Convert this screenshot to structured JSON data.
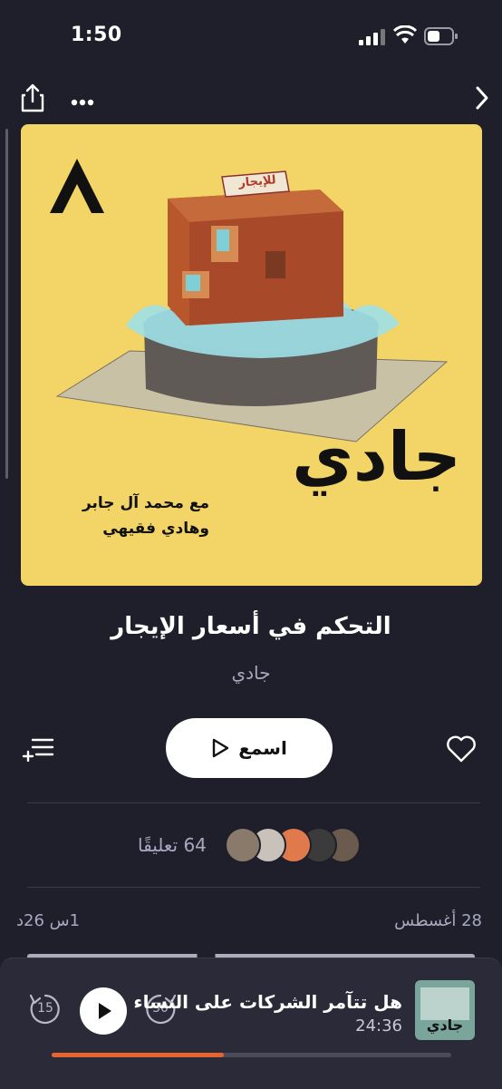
{
  "status_bar": {
    "time": "1:50",
    "battery_level": 0.5
  },
  "artwork": {
    "number_glyph": "٨",
    "sign_text": "للإيجار",
    "logo_text": "جادي",
    "hosts_line1": "مع محمد آل جابر",
    "hosts_line2": "وهادي فقيهي",
    "background_color": "#f3d466"
  },
  "episode": {
    "title": "التحكم في أسعار الإيجار",
    "show": "جادي"
  },
  "actions": {
    "play_label": "اسمع"
  },
  "comments": {
    "label": "64 تعليقًا"
  },
  "meta": {
    "date": "28 أغسطس",
    "duration": "1س 26د"
  },
  "mini_player": {
    "title": "هل تتآمر الشركات على النساء",
    "time": "24:36",
    "progress": 0.43,
    "skip_back": "15",
    "skip_forward": "30",
    "thumb_text": "جادي",
    "accent_color": "#e8642f"
  }
}
